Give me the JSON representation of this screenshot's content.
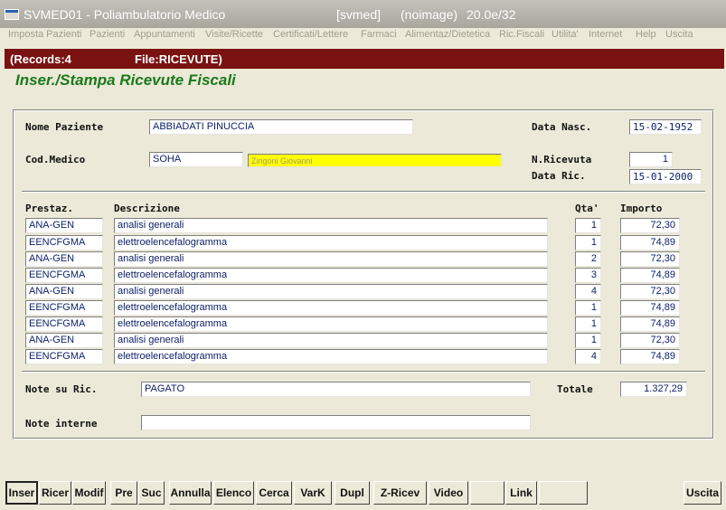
{
  "window": {
    "title": "SVMED01 - Poliambulatorio Medico",
    "instance": "[svmed]",
    "image": "(noimage)",
    "version": "20.0e/32"
  },
  "menu": [
    {
      "label": "Imposta Pazienti"
    },
    {
      "label": "Pazienti"
    },
    {
      "label": "Appuntamenti"
    },
    {
      "label": "Visite/Ricette"
    },
    {
      "label": "Certificati/Lettere"
    },
    {
      "label": "Farmaci"
    },
    {
      "label": "Alimentaz/Dietetica"
    },
    {
      "label": "Ric.Fiscali"
    },
    {
      "label": "Utilita'"
    },
    {
      "label": "Internet"
    },
    {
      "label": "Help"
    },
    {
      "label": "Uscita"
    }
  ],
  "info": {
    "records": "(Records:4",
    "file": "File:RICEVUTE)"
  },
  "form": {
    "title": "Inser./Stampa Ricevute Fiscali",
    "nome_label": "Nome Paziente",
    "nome_value": "ABBIADATI PINUCCIA",
    "data_nasc_label": "Data Nasc.",
    "data_nasc_value": "15-02-1952",
    "cod_medico_label": "Cod.Medico",
    "cod_medico_value": "SOHA",
    "medico_name": "Zingoni Giovanni",
    "n_ricevuta_label": "N.Ricevuta",
    "n_ricevuta_value": "1",
    "data_ric_label": "Data Ric.",
    "data_ric_value": "15-01-2000"
  },
  "table": {
    "headers": {
      "prestaz": "Prestaz.",
      "descrizione": "Descrizione",
      "qta": "Qta'",
      "importo": "Importo"
    },
    "rows": [
      {
        "code": "ANA-GEN",
        "desc": "analisi generali",
        "qta": "1",
        "importo": "72,30"
      },
      {
        "code": "EENCFGMA",
        "desc": "elettroelencefalogramma",
        "qta": "1",
        "importo": "74,89"
      },
      {
        "code": "ANA-GEN",
        "desc": "analisi generali",
        "qta": "2",
        "importo": "72,30"
      },
      {
        "code": "EENCFGMA",
        "desc": "elettroelencefalogramma",
        "qta": "3",
        "importo": "74,89"
      },
      {
        "code": "ANA-GEN",
        "desc": "analisi generali",
        "qta": "4",
        "importo": "72,30"
      },
      {
        "code": "EENCFGMA",
        "desc": "elettroelencefalogramma",
        "qta": "1",
        "importo": "74,89"
      },
      {
        "code": "EENCFGMA",
        "desc": "elettroelencefalogramma",
        "qta": "1",
        "importo": "74,89"
      },
      {
        "code": "ANA-GEN",
        "desc": "analisi generali",
        "qta": "1",
        "importo": "72,30"
      },
      {
        "code": "EENCFGMA",
        "desc": "elettroelencefalogramma",
        "qta": "4",
        "importo": "74,89"
      }
    ]
  },
  "footer": {
    "note_ric_label": "Note su Ric.",
    "note_ric_value": "PAGATO",
    "totale_label": "Totale",
    "totale_value": "1.327,29",
    "note_interne_label": "Note interne",
    "note_interne_value": ""
  },
  "buttons": [
    {
      "label": "Inser",
      "active": true
    },
    {
      "label": "Ricer"
    },
    {
      "label": "Modif"
    },
    {
      "label": "Pre"
    },
    {
      "label": "Suc"
    },
    {
      "label": "Annulla"
    },
    {
      "label": "Elenco"
    },
    {
      "label": "Cerca"
    },
    {
      "label": "VarK"
    },
    {
      "label": "Dupl"
    },
    {
      "label": "Z-Ricev"
    },
    {
      "label": "Video"
    },
    {
      "label": ""
    },
    {
      "label": "Link"
    },
    {
      "label": ""
    },
    {
      "label": "Uscita"
    }
  ]
}
